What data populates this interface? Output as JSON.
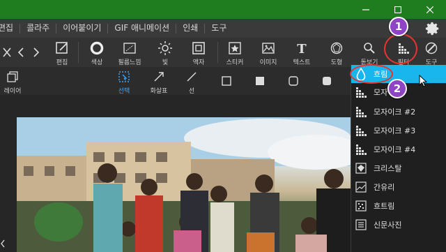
{
  "menubar": {
    "items": [
      "편집",
      "콜라주",
      "이어붙이기",
      "GIF 애니메이션",
      "인쇄",
      "도구"
    ]
  },
  "toolbar": {
    "edit": "편집",
    "color": "색상",
    "film": "필름느낌",
    "light": "빛",
    "frame": "액자",
    "sticker": "스티커",
    "image": "이미지",
    "text": "텍스트",
    "shape": "도형",
    "magnifier": "돋보기",
    "filter": "필터",
    "tools": "도구"
  },
  "subbar": {
    "layer": "레이어",
    "select": "선택",
    "arrow": "화살표",
    "line": "선"
  },
  "dropdown": {
    "items": [
      "흐림",
      "모자이크",
      "모자이크 #2",
      "모자이크 #3",
      "모자이크 #4",
      "크리스탈",
      "간유리",
      "흐트림",
      "신문사진"
    ],
    "selected_index": 0
  },
  "callouts": {
    "first": "1",
    "second": "2"
  },
  "colors": {
    "titlebar": "#1f7d1f",
    "selection": "#19b6ee",
    "callout_badge": "#8e44c4",
    "callout_ring": "#e53333",
    "active_tool": "#3aa8ff"
  }
}
